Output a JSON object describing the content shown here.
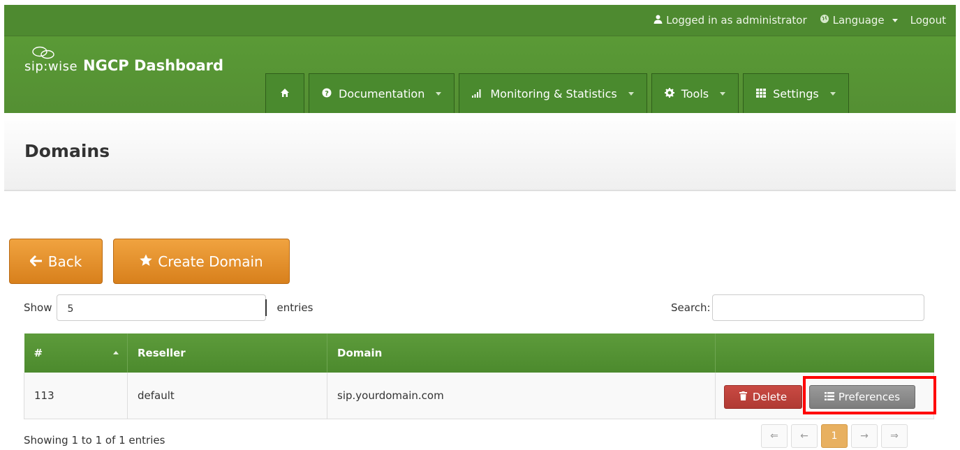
{
  "topbar": {
    "logged_in": "Logged in as administrator",
    "language": "Language",
    "logout": "Logout"
  },
  "brand": {
    "logo_text": "sip:wise",
    "title": "NGCP Dashboard"
  },
  "nav": {
    "home_icon": "home-icon",
    "items": [
      {
        "label": "Documentation",
        "icon": "question-circle-icon"
      },
      {
        "label": "Monitoring & Statistics",
        "icon": "signal-bars-icon"
      },
      {
        "label": "Tools",
        "icon": "gear-icon"
      },
      {
        "label": "Settings",
        "icon": "grid-icon"
      }
    ]
  },
  "page": {
    "title": "Domains"
  },
  "actions": {
    "back": "Back",
    "create": "Create Domain"
  },
  "table_controls": {
    "show_label": "Show",
    "page_size": "5",
    "entries_label": "entries",
    "search_label": "Search:"
  },
  "table": {
    "columns": [
      "#",
      "Reseller",
      "Domain",
      ""
    ],
    "rows": [
      {
        "id": "113",
        "reseller": "default",
        "domain": "sip.yourdomain.com"
      }
    ],
    "delete_label": "Delete",
    "preferences_label": "Preferences"
  },
  "footer": {
    "info": "Showing 1 to 1 of 1 entries",
    "pager": [
      "⇐",
      "←",
      "1",
      "→",
      "⇒"
    ],
    "current_page": "1"
  },
  "colors": {
    "header_green": "#548f33",
    "button_orange": "#e8912c",
    "delete_red": "#b83f38",
    "highlight": "#ff0000"
  }
}
